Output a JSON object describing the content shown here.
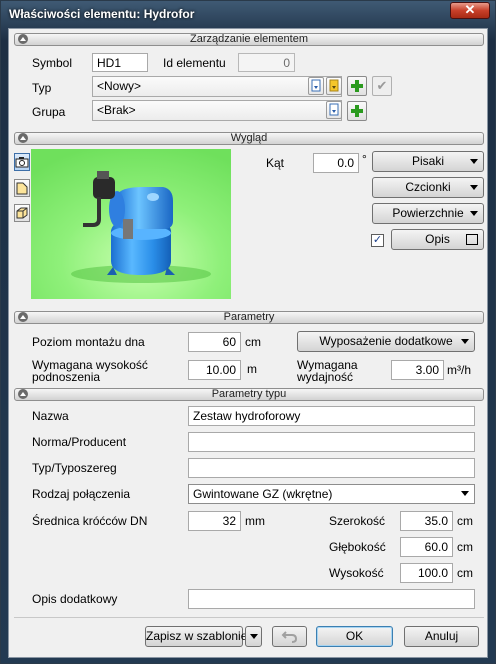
{
  "window": {
    "title": "Właściwości elementu: Hydrofor",
    "close": "✕"
  },
  "sections": {
    "management": "Zarządzanie elementem",
    "appearance": "Wygląd",
    "parameters": "Parametry",
    "type_parameters": "Parametry typu"
  },
  "management": {
    "symbol_label": "Symbol",
    "symbol_value": "HD1",
    "id_label": "Id elementu",
    "id_value": "0",
    "type_label": "Typ",
    "type_value": "<Nowy>",
    "group_label": "Grupa",
    "group_value": "<Brak>",
    "check_glyph": "✔"
  },
  "appearance": {
    "angle_label": "Kąt",
    "angle_value": "0.0",
    "angle_unit": "°",
    "pens_button": "Pisaki",
    "fonts_button": "Czcionki",
    "surfaces_button": "Powierzchnie",
    "description_button": "Opis",
    "description_checked": true,
    "check_glyph": "✓"
  },
  "parameters": {
    "mount_label": "Poziom montażu dna",
    "mount_value": "60",
    "mount_unit": "cm",
    "extra_button": "Wyposażenie dodatkowe",
    "height_label": "Wymagana wysokość podnoszenia",
    "height_value": "10.00",
    "height_unit": "m",
    "capacity_label": "Wymagana wydajność",
    "capacity_value": "3.00",
    "capacity_unit": "m³/h"
  },
  "type_parameters": {
    "name_label": "Nazwa",
    "name_value": "Zestaw hydroforowy",
    "norm_label": "Norma/Producent",
    "norm_value": "",
    "series_label": "Typ/Typoszereg",
    "series_value": "",
    "connection_label": "Rodzaj połączenia",
    "connection_value": "Gwintowane GZ (wkrętne)",
    "diameter_label": "Średnica króćców DN",
    "diameter_value": "32",
    "diameter_unit": "mm",
    "width_label": "Szerokość",
    "width_value": "35.0",
    "width_unit": "cm",
    "depth_label": "Głębokość",
    "depth_value": "60.0",
    "depth_unit": "cm",
    "tall_label": "Wysokość",
    "tall_value": "100.0",
    "tall_unit": "cm",
    "notes_label": "Opis dodatkowy",
    "notes_value": ""
  },
  "footer": {
    "save_template": "Zapisz w szablonie",
    "ok": "OK",
    "cancel": "Anuluj"
  },
  "colors": {
    "preview_bg": "#8ff07a",
    "tank_blue": "#2a8ee8",
    "title_bg": "#2b4560"
  }
}
